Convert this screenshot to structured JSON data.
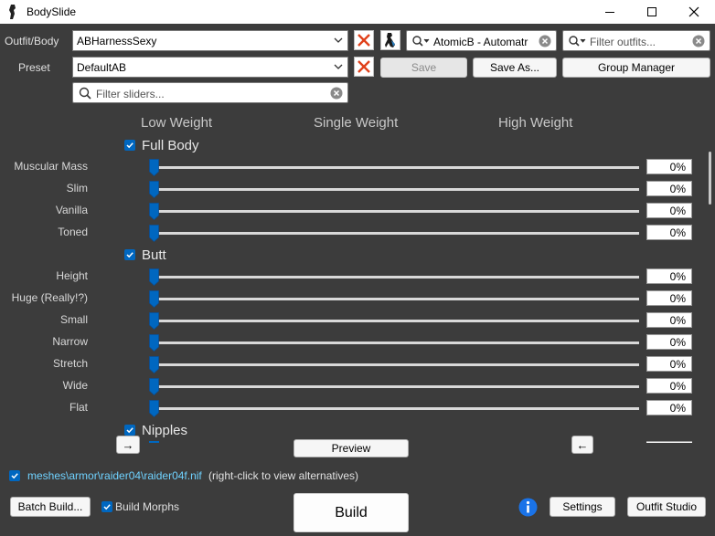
{
  "window": {
    "title": "BodySlide"
  },
  "outfit": {
    "label": "Outfit/Body",
    "selected": "ABHarnessSexy",
    "group_filter_value": "AtomicB - Automatr",
    "outfit_filter_placeholder": "Filter outfits..."
  },
  "preset": {
    "label": "Preset",
    "selected": "DefaultAB",
    "save_label": "Save",
    "save_as_label": "Save As...",
    "group_manager_label": "Group Manager"
  },
  "slider_filter_placeholder": "Filter sliders...",
  "columns": {
    "low": "Low Weight",
    "single": "Single Weight",
    "high": "High Weight"
  },
  "groups": [
    {
      "name": "Full Body",
      "sliders": [
        {
          "label": "Muscular Mass",
          "value": "0%"
        },
        {
          "label": "Slim",
          "value": "0%"
        },
        {
          "label": "Vanilla",
          "value": "0%"
        },
        {
          "label": "Toned",
          "value": "0%"
        }
      ]
    },
    {
      "name": "Butt",
      "sliders": [
        {
          "label": "Height",
          "value": "0%"
        },
        {
          "label": "Huge (Really!?)",
          "value": "0%"
        },
        {
          "label": "Small",
          "value": "0%"
        },
        {
          "label": "Narrow",
          "value": "0%"
        },
        {
          "label": "Stretch",
          "value": "0%"
        },
        {
          "label": "Wide",
          "value": "0%"
        },
        {
          "label": "Flat",
          "value": "0%"
        }
      ]
    },
    {
      "name": "Nipples",
      "sliders": []
    }
  ],
  "nav": {
    "right_arrow": "→",
    "left_arrow": "←",
    "preview_label": "Preview"
  },
  "mesh": {
    "path": "meshes\\armor\\raider04\\raider04f.nif",
    "hint": "(right-click to view alternatives)"
  },
  "bottom": {
    "batch_build_label": "Batch Build...",
    "build_morphs_label": "Build Morphs",
    "build_label": "Build",
    "settings_label": "Settings",
    "outfit_studio_label": "Outfit Studio"
  },
  "colors": {
    "background": "#3c3c3c",
    "accent": "#0067c0",
    "clear_x": "#e0401a",
    "link": "#6fd2ff"
  }
}
